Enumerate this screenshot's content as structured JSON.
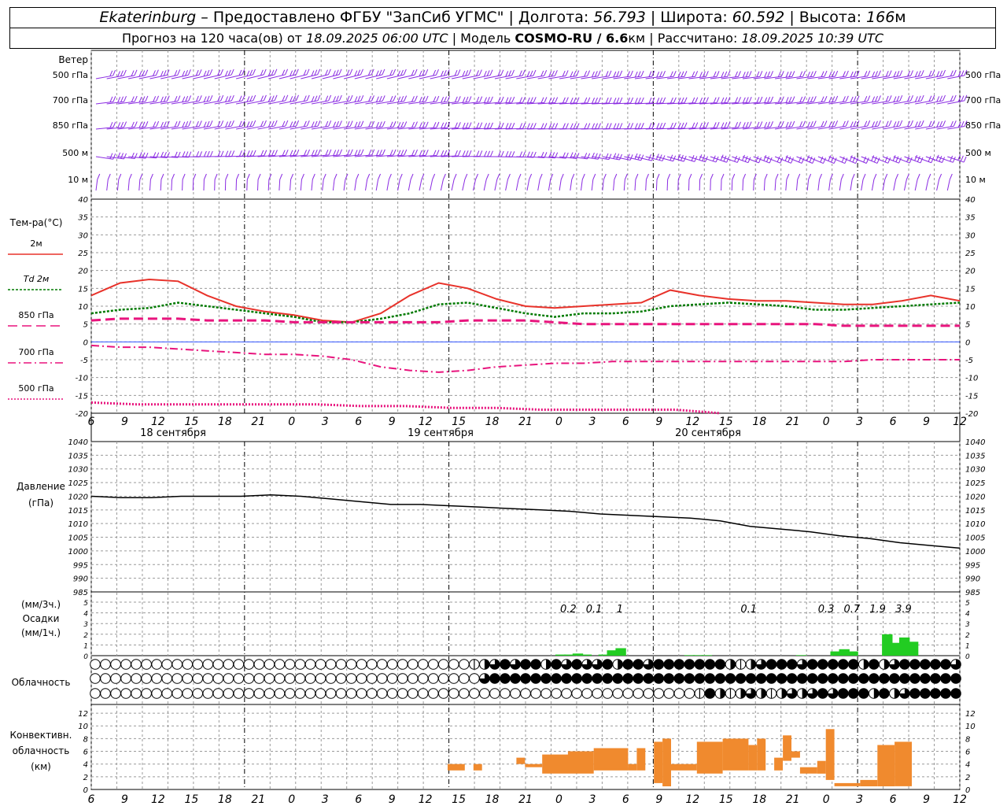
{
  "header": {
    "city": "Ekaterinburg",
    "provider": "– Предоставлено ФГБУ \"ЗапСиб УГМС\" | Долгота:",
    "lon": "56.793",
    "lat_label": "| Широта:",
    "lat": "60.592",
    "alt_label": "| Высота:",
    "alt": "166",
    "alt_unit": "м",
    "forecast_prefix": "Прогноз на 120 часа(ов) от",
    "start": "18.09.2025 06:00 UTC",
    "model_label": "| Модель",
    "model": "COSMO-RU / 6.6",
    "model_unit": "км",
    "calc_label": "| Рассчитано:",
    "calc": "18.09.2025 10:39 UTC"
  },
  "colors": {
    "wind": "#8a2be2",
    "t2m": "#e8322a",
    "td2m": "#007a00",
    "t_levels": "#e8147d",
    "zero_line": "#3355ff",
    "pressure": "#000000",
    "precip": "#22cc22",
    "conv": "#f08a2e",
    "grid": "#9a9a9a"
  },
  "chart_data": {
    "type": "meteogram",
    "x_hour_labels": [
      "6",
      "9",
      "12",
      "15",
      "18",
      "21",
      "0",
      "3",
      "6",
      "9",
      "12",
      "15",
      "18",
      "21",
      "0",
      "3",
      "6",
      "9",
      "12",
      "15",
      "18",
      "21",
      "0",
      "3",
      "6",
      "9",
      "12"
    ],
    "day_labels": [
      "18 сентября",
      "19 сентября",
      "20 сентября"
    ],
    "wind": {
      "title": "Ветер",
      "levels": [
        "500 гПа",
        "700 гПа",
        "850 гПа",
        "500 м",
        "10 м"
      ]
    },
    "temperature": {
      "title": "Тем-ра(°C)",
      "ylim": [
        -20,
        40
      ],
      "ticks": [
        "-20",
        "-15",
        "-10",
        "-5",
        "0",
        "5",
        "10",
        "15",
        "20",
        "25",
        "30",
        "35",
        "40"
      ],
      "legend": [
        "2м",
        "Td 2м",
        "850 гПа",
        "700 гПа",
        "500 гПа"
      ],
      "series": [
        {
          "name": "2м",
          "values": [
            13,
            16.5,
            17.5,
            17,
            13,
            10,
            8.5,
            7.5,
            6,
            5.5,
            8,
            13,
            16.5,
            15,
            12,
            10,
            9.5,
            10,
            10.5,
            11,
            14.5,
            13,
            12,
            11.5,
            11.5,
            11,
            10.5,
            10.5,
            11.5,
            13,
            11.5
          ]
        },
        {
          "name": "Td 2м",
          "values": [
            8,
            9,
            9.5,
            11,
            10,
            9,
            8,
            7,
            5.5,
            5.5,
            6.5,
            8,
            10.5,
            11,
            9.5,
            8,
            7,
            8,
            8,
            8.5,
            10,
            10.5,
            11,
            10.5,
            10,
            9,
            9,
            9.5,
            10,
            10.5,
            11
          ]
        },
        {
          "name": "850 гПа",
          "values": [
            6,
            6.5,
            6.5,
            6.5,
            6,
            6,
            6,
            5.5,
            5.5,
            5.5,
            5.5,
            5.5,
            5.5,
            6,
            6,
            6,
            5.5,
            5,
            5,
            5,
            5,
            5,
            5,
            5,
            5,
            5,
            4.5,
            4.5,
            4.5,
            4.5,
            4.5
          ]
        },
        {
          "name": "700 гПа",
          "values": [
            -1,
            -1.5,
            -1.5,
            -2,
            -2.5,
            -3,
            -3.5,
            -3.5,
            -4,
            -5,
            -7,
            -8,
            -8.5,
            -8,
            -7,
            -6.5,
            -6,
            -6,
            -5.5,
            -5.5,
            -5.5,
            -5.5,
            -5.5,
            -5.5,
            -5.5,
            -5.5,
            -5.5,
            -5,
            -5,
            -5,
            -5
          ]
        },
        {
          "name": "500 гПа",
          "values": [
            -17,
            -17.5,
            -17.5,
            -17.5,
            -17.5,
            -17.5,
            -18,
            -18,
            -18.5,
            -18.5,
            -19,
            -19,
            -19,
            -19,
            -20
          ]
        }
      ]
    },
    "pressure": {
      "title": "Давление",
      "unit": "(гПа)",
      "ylim": [
        985,
        1040
      ],
      "ticks": [
        "985",
        "990",
        "995",
        "1000",
        "1005",
        "1010",
        "1015",
        "1020",
        "1025",
        "1030",
        "1035",
        "1040"
      ],
      "values": [
        1020,
        1019.5,
        1019.5,
        1020,
        1020,
        1020,
        1020.5,
        1020,
        1019,
        1018,
        1017,
        1017,
        1016.5,
        1016,
        1015.5,
        1015,
        1014.5,
        1013.5,
        1013,
        1012.5,
        1012,
        1011,
        1009,
        1008,
        1007,
        1005.5,
        1004.5,
        1003,
        1002,
        1001
      ]
    },
    "precipitation": {
      "title": "Осадки",
      "unit_3h": "(мм/3ч.)",
      "unit_1h": "(мм/1ч.)",
      "ylim": [
        0,
        5
      ],
      "ticks": [
        "0",
        "1",
        "2",
        "3",
        "4",
        "5"
      ],
      "sums_3h": [
        {
          "hour": 57,
          "label": "0.2"
        },
        {
          "hour": 60,
          "label": "0.1"
        },
        {
          "hour": 63,
          "label": "1"
        },
        {
          "hour": 78,
          "label": "0.1"
        },
        {
          "hour": 87,
          "label": "0.3"
        },
        {
          "hour": 90,
          "label": "0.7"
        },
        {
          "hour": 93,
          "label": "1.9"
        },
        {
          "hour": 96,
          "label": "3.9"
        }
      ],
      "hourly": [
        {
          "hour": 55,
          "value": 0.1
        },
        {
          "hour": 56,
          "value": 0.1
        },
        {
          "hour": 57,
          "value": 0.2
        },
        {
          "hour": 58,
          "value": 0.1
        },
        {
          "hour": 60,
          "value": 0.1
        },
        {
          "hour": 61,
          "value": 0.5
        },
        {
          "hour": 62,
          "value": 0.7
        },
        {
          "hour": 70,
          "value": 0.05
        },
        {
          "hour": 71,
          "value": 0.05
        },
        {
          "hour": 72,
          "value": 0.05
        },
        {
          "hour": 83,
          "value": 0.05
        },
        {
          "hour": 87,
          "value": 0.4
        },
        {
          "hour": 88,
          "value": 0.6
        },
        {
          "hour": 89,
          "value": 0.4
        },
        {
          "hour": 93,
          "value": 2.0
        },
        {
          "hour": 94,
          "value": 1.2
        },
        {
          "hour": 95,
          "value": 1.7
        },
        {
          "hour": 96,
          "value": 1.3
        }
      ]
    },
    "cloudiness": {
      "title": "Облачность",
      "rows": [
        "0000000000000000000000000000000000000123434424343342443444444421234443444442423444443",
        "0000000000000000000000000000000000000034444444444444444444444444444444444444444444444",
        "0000000000000000000000000000000000000000000000000000000000014212321232343444242344444"
      ]
    },
    "convective": {
      "title": "Конвективн.",
      "title2": "облачность",
      "unit": "(км)",
      "ylim": [
        0,
        13
      ],
      "ticks": [
        "0",
        "2",
        "4",
        "6",
        "8",
        "10",
        "12"
      ],
      "layers": [
        {
          "from": 40,
          "to": 42,
          "base": 3,
          "top": 4
        },
        {
          "from": 43,
          "to": 44,
          "base": 3,
          "top": 4
        },
        {
          "from": 48,
          "to": 49,
          "base": 4,
          "top": 5
        },
        {
          "from": 49,
          "to": 51,
          "base": 3.5,
          "top": 4
        },
        {
          "from": 51,
          "to": 54,
          "base": 2.5,
          "top": 5.5
        },
        {
          "from": 54,
          "to": 57,
          "base": 2.5,
          "top": 6
        },
        {
          "from": 57,
          "to": 61,
          "base": 3,
          "top": 6.5
        },
        {
          "from": 61,
          "to": 62,
          "base": 3,
          "top": 4
        },
        {
          "from": 62,
          "to": 63,
          "base": 3,
          "top": 6.5
        },
        {
          "from": 64,
          "to": 65,
          "base": 1,
          "top": 7.5
        },
        {
          "from": 65,
          "to": 66,
          "base": 0.5,
          "top": 8
        },
        {
          "from": 66,
          "to": 69,
          "base": 3,
          "top": 4
        },
        {
          "from": 69,
          "to": 72,
          "base": 2.5,
          "top": 7.5
        },
        {
          "from": 72,
          "to": 75,
          "base": 3,
          "top": 8
        },
        {
          "from": 75,
          "to": 76,
          "base": 3,
          "top": 7
        },
        {
          "from": 76,
          "to": 77,
          "base": 3,
          "top": 8
        },
        {
          "from": 78,
          "to": 79,
          "base": 3,
          "top": 5
        },
        {
          "from": 79,
          "to": 80,
          "base": 4.5,
          "top": 8.5
        },
        {
          "from": 80,
          "to": 81,
          "base": 5,
          "top": 6
        },
        {
          "from": 81,
          "to": 83,
          "base": 2.5,
          "top": 3.5
        },
        {
          "from": 83,
          "to": 84,
          "base": 2.5,
          "top": 4.5
        },
        {
          "from": 84,
          "to": 85,
          "base": 1.5,
          "top": 9.5
        },
        {
          "from": 85,
          "to": 88,
          "base": 0.5,
          "top": 1
        },
        {
          "from": 88,
          "to": 90,
          "base": 0.5,
          "top": 1.5
        },
        {
          "from": 90,
          "to": 92,
          "base": 0.5,
          "top": 7
        },
        {
          "from": 92,
          "to": 94,
          "base": 0.5,
          "top": 7.5
        }
      ]
    }
  }
}
